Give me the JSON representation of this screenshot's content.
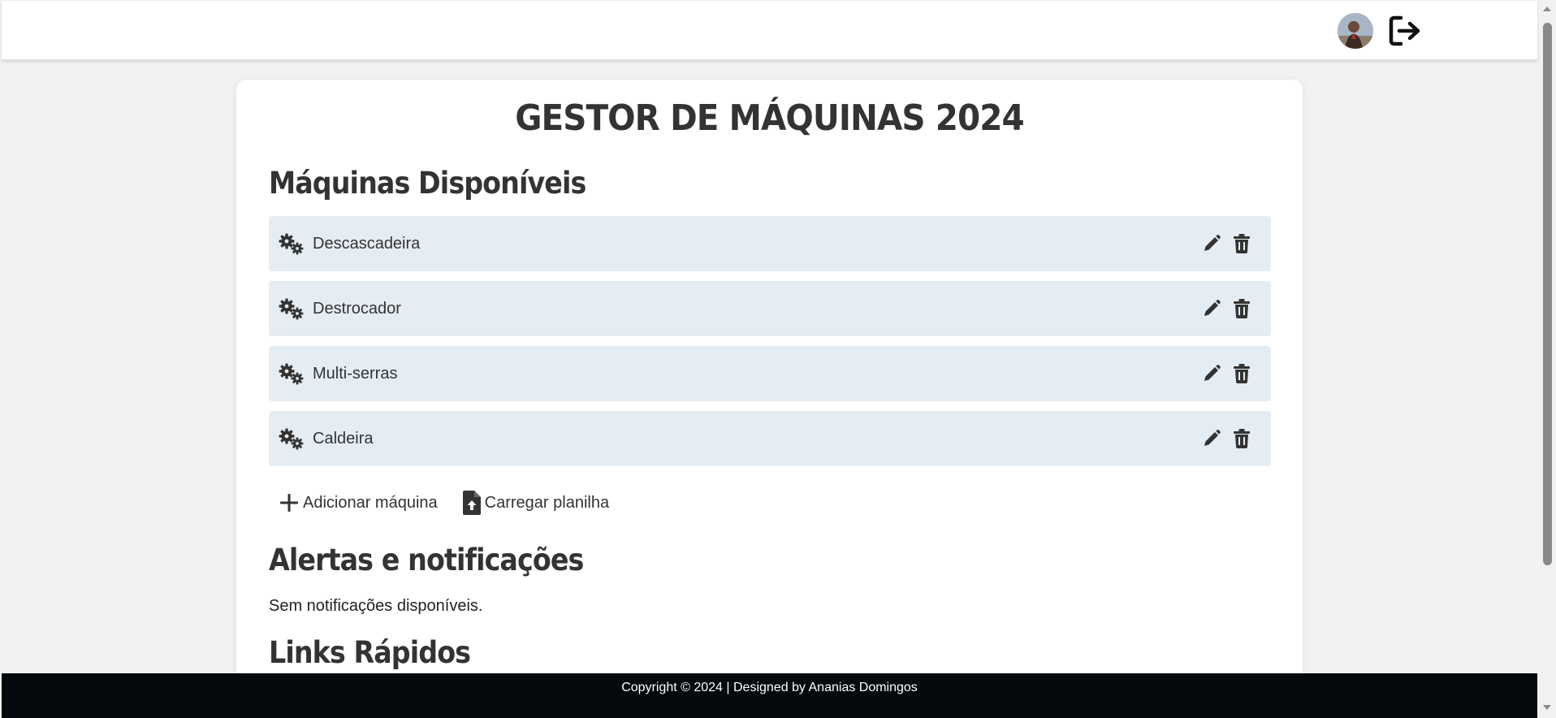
{
  "header": {
    "avatar_icon": "user-avatar",
    "logout_icon": "logout-icon"
  },
  "main": {
    "title": "GESTOR DE MÁQUINAS 2024",
    "machines_heading": "Máquinas Disponíveis",
    "machines": [
      {
        "name": "Descascadeira"
      },
      {
        "name": "Destrocador"
      },
      {
        "name": "Multi-serras"
      },
      {
        "name": "Caldeira"
      }
    ],
    "add_machine_label": "Adicionar máquina",
    "upload_sheet_label": "Carregar planilha",
    "alerts_heading": "Alertas e notificações",
    "alerts_empty": "Sem notificações disponíveis.",
    "quick_links_heading": "Links Rápidos"
  },
  "footer": {
    "text": "Copyright © 2024 | Designed by Ananias Domingos"
  },
  "colors": {
    "row_background": "#e5edf4",
    "footer_background": "#05080c",
    "page_background": "#f2f2f2"
  }
}
